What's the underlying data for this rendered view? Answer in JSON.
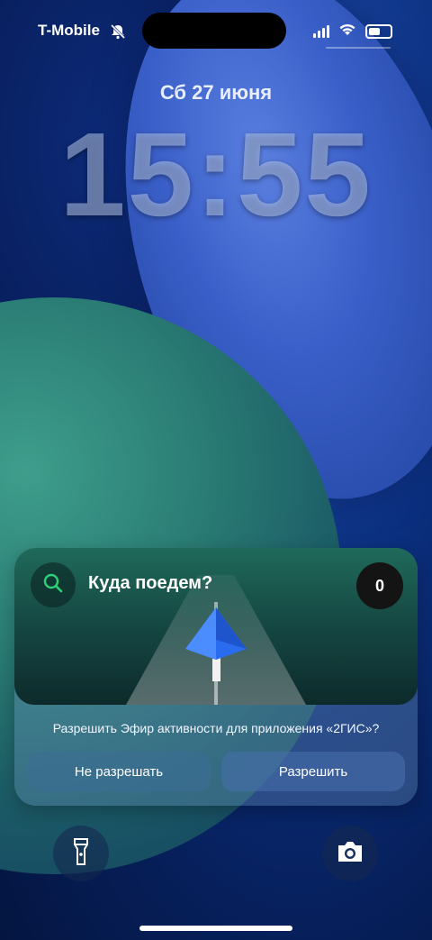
{
  "status_bar": {
    "carrier": "T-Mobile",
    "icons": [
      "bell-slash-icon",
      "signal-icon",
      "wifi-icon",
      "battery-icon"
    ],
    "battery_level": 0.4
  },
  "lock_screen": {
    "date": "Сб 27 июня",
    "time": "15:55"
  },
  "widget": {
    "title": "Куда поедем?",
    "count": "0",
    "icons": [
      "search-icon",
      "navigation-arrow-icon"
    ],
    "accent_color": "#2fd07a",
    "prompt": "Разрешить Эфир активности для приложения «2ГИС»?",
    "deny_label": "Не разрешать",
    "allow_label": "Разрешить"
  },
  "bottom_controls": {
    "left_icon": "flashlight-icon",
    "right_icon": "camera-icon"
  }
}
